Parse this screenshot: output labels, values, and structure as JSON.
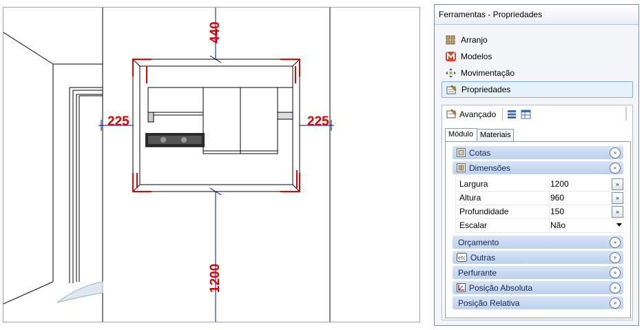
{
  "viewport": {
    "dimensions": {
      "top": "440",
      "left": "225",
      "right": "225",
      "bottom": "1200"
    }
  },
  "panel": {
    "title": "Ferramentas - Propriedades",
    "nav": [
      {
        "label": "Arranjo",
        "icon": "grid-icon"
      },
      {
        "label": "Modelos",
        "icon": "m-logo-icon"
      },
      {
        "label": "Movimentação",
        "icon": "move-arrows-icon"
      },
      {
        "label": "Propriedades",
        "icon": "properties-icon",
        "selected": true
      }
    ],
    "advanced": {
      "label": "Avançado",
      "tabs": [
        {
          "label": "Módulo",
          "active": true
        },
        {
          "label": "Materiais",
          "active": false
        }
      ],
      "sections": {
        "cotas": "Cotas",
        "dimensoes": "Dimensões",
        "orcamento": "Orçamento",
        "outras": "Outras",
        "perfurante": "Perfurante",
        "posicao_absoluta": "Posição Absoluta",
        "posicao_relativa": "Posição Relativa"
      },
      "outras_icon_text": "etc",
      "properties": [
        {
          "name": "Largura",
          "value": "1200",
          "button": "»"
        },
        {
          "name": "Altura",
          "value": "960",
          "button": "»"
        },
        {
          "name": "Profundidade",
          "value": "150",
          "button": "»"
        },
        {
          "name": "Escalar",
          "value": "Não"
        }
      ],
      "chevrons": {
        "expand": "»",
        "collapse": "«"
      }
    }
  }
}
